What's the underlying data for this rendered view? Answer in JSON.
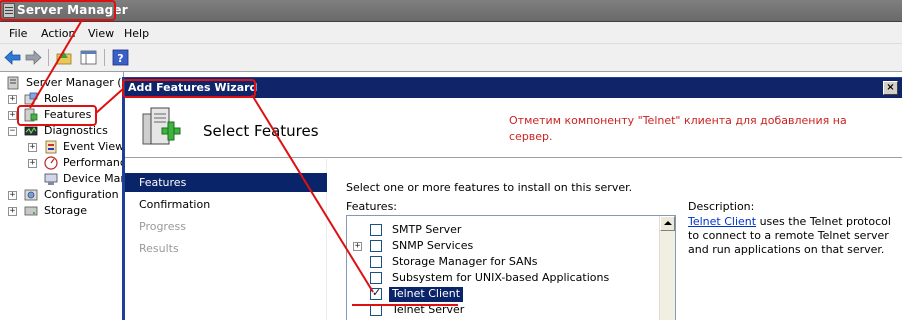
{
  "app": {
    "title": "Server Manager"
  },
  "menu": {
    "items": [
      "File",
      "Action",
      "View",
      "Help"
    ]
  },
  "toolbar": {
    "icons": [
      "back-arrow-icon",
      "forward-arrow-icon",
      "up-folder-icon",
      "show-hide-tree-icon",
      "help-icon"
    ]
  },
  "tree": {
    "items": [
      {
        "label": "Server Manager (AL",
        "icon": "server-icon",
        "level": 0,
        "expander": ""
      },
      {
        "label": "Roles",
        "icon": "roles-icon",
        "level": 1,
        "expander": "+"
      },
      {
        "label": "Features",
        "icon": "features-icon",
        "level": 1,
        "expander": "+"
      },
      {
        "label": "Diagnostics",
        "icon": "diagnostics-icon",
        "level": 1,
        "expander": "−"
      },
      {
        "label": "Event Viewe",
        "icon": "event-viewer-icon",
        "level": 2,
        "expander": "+"
      },
      {
        "label": "Performance",
        "icon": "performance-icon",
        "level": 2,
        "expander": "+"
      },
      {
        "label": "Device Mana",
        "icon": "device-manager-icon",
        "level": 2,
        "expander": ""
      },
      {
        "label": "Configuration",
        "icon": "configuration-icon",
        "level": 1,
        "expander": "+"
      },
      {
        "label": "Storage",
        "icon": "storage-icon",
        "level": 1,
        "expander": "+"
      }
    ]
  },
  "wizard": {
    "title": "Add Features Wizard",
    "close": "×",
    "page_title": "Select Features",
    "annotation": "Отметим компоненту \"Telnet\" клиента для добавления на сервер.",
    "nav": [
      {
        "label": "Features",
        "state": "active"
      },
      {
        "label": "Confirmation",
        "state": "normal"
      },
      {
        "label": "Progress",
        "state": "disabled"
      },
      {
        "label": "Results",
        "state": "disabled"
      }
    ],
    "instruction": "Select one or more features to install on this server.",
    "features_label": "Features:",
    "features": [
      {
        "label": "SMTP Server",
        "checked": false,
        "expander": "",
        "selected": false
      },
      {
        "label": "SNMP Services",
        "checked": false,
        "expander": "+",
        "selected": false
      },
      {
        "label": "Storage Manager for SANs",
        "checked": false,
        "expander": "",
        "selected": false
      },
      {
        "label": "Subsystem for UNIX-based Applications",
        "checked": false,
        "expander": "",
        "selected": false
      },
      {
        "label": "Telnet Client",
        "checked": true,
        "expander": "",
        "selected": true
      },
      {
        "label": "Telnet Server",
        "checked": false,
        "expander": "",
        "selected": false
      }
    ],
    "description_label": "Description:",
    "description_link": "Telnet Client",
    "description_text": " uses the Telnet protocol to connect to a remote Telnet server and run applications on that server."
  },
  "colors": {
    "annotation_red": "#dd1111",
    "nav_active": "#0a246a",
    "wizard_titlebar": "#10246a",
    "link": "#0033cc"
  }
}
